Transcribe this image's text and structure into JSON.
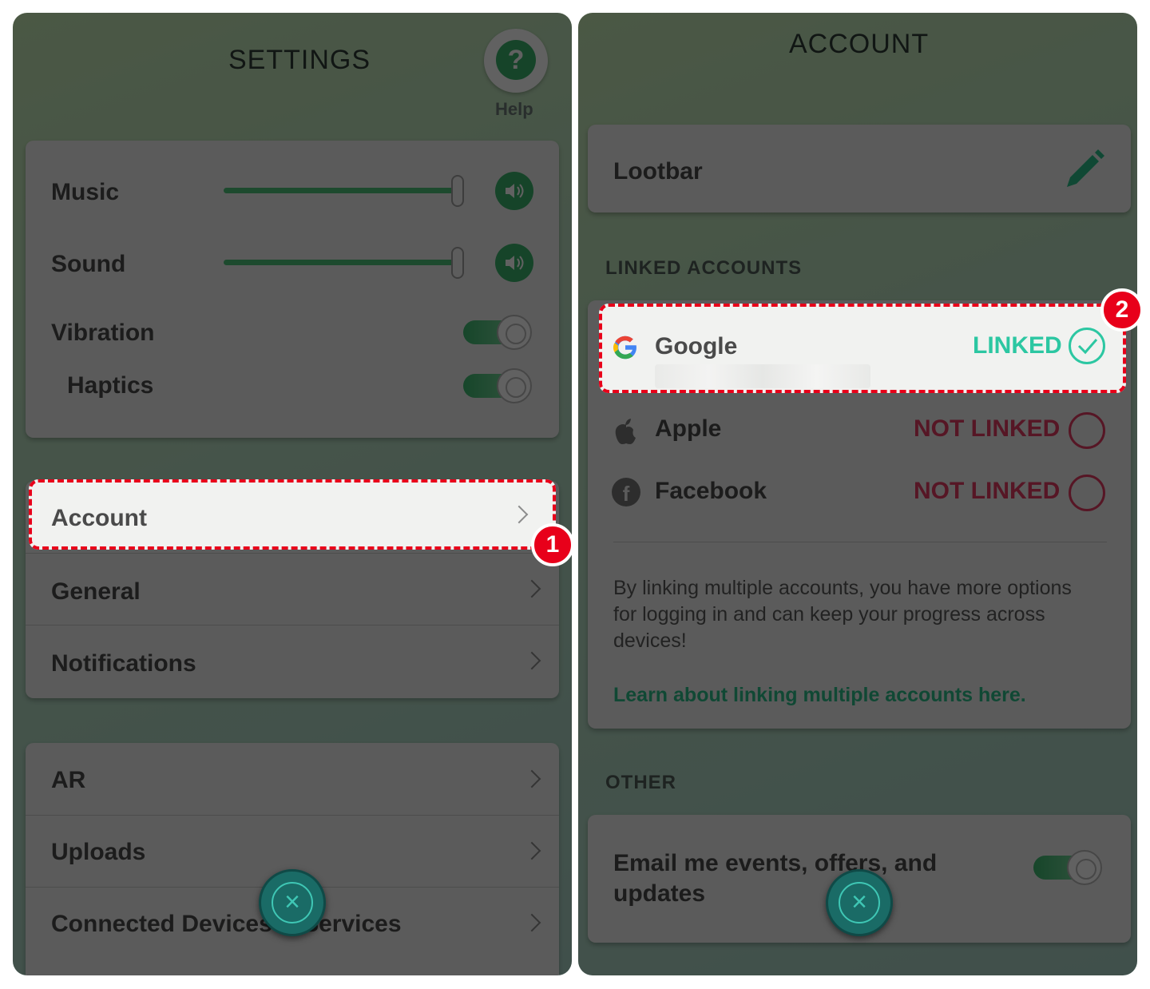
{
  "settings": {
    "title": "SETTINGS",
    "help_label": "Help",
    "help_glyph": "?",
    "audio": [
      {
        "label": "Music",
        "level": 1.0
      },
      {
        "label": "Sound",
        "level": 1.0
      }
    ],
    "vibration_label": "Vibration",
    "haptics_label": "Haptics",
    "menu_group_1": [
      "Account",
      "General",
      "Notifications"
    ],
    "menu_group_2": [
      "AR",
      "Uploads",
      "Connected Devices & Services"
    ],
    "close_glyph": "×"
  },
  "account": {
    "title": "ACCOUNT",
    "username": "Lootbar",
    "linked_accounts_header": "LINKED ACCOUNTS",
    "providers": [
      {
        "name": "Google",
        "status": "LINKED",
        "icon": "google-icon"
      },
      {
        "name": "Apple",
        "status": "NOT LINKED",
        "icon": "apple-icon"
      },
      {
        "name": "Facebook",
        "status": "NOT LINKED",
        "icon": "facebook-icon"
      }
    ],
    "info_text": "By linking multiple accounts, you have more options for logging in and can keep your progress across devices!",
    "learn_link": "Learn about linking multiple accounts here.",
    "other_header": "OTHER",
    "email_toggle_label": "Email me events, offers, and updates",
    "close_glyph": "×"
  },
  "annotations": {
    "step1": "1",
    "step2": "2"
  },
  "colors": {
    "accent_green": "#3bb36c",
    "linked": "#2cc7a2",
    "not_linked": "#e23c62",
    "highlight": "#e8001a"
  }
}
